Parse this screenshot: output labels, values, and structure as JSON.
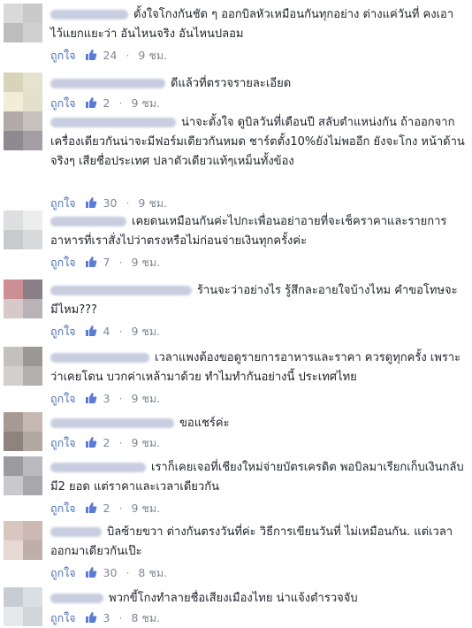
{
  "like_label": "ถูกใจ",
  "dot": "·",
  "comments": [
    {
      "text": "ตั้งใจโกงกันชัด ๆ ออกบิลหัวเหมือนกันทุกอย่าง ต่างแค่วันที่ คงเอาไว้แยกแยะว่า อันไหนจริง อันไหนปลอม",
      "likes": "24",
      "time": "9 ชม."
    },
    {
      "text": "ดีแล้วที่ตรวจรายละเอียด",
      "likes": "2",
      "time": "9 ชม."
    },
    {
      "text": "น่าจะตั้งใจ ดูบิลวันที่เดือนปี สลับตำแหน่งกัน ถ้าออกจากเครื่องเดียวกันน่าจะมีฟอร์มเดียวกันหมด ชาร์ตตั้ง10%ยังไม่พออีก ยังจะโกง หน้าด้านจริงๆ เสียชื่อประเทศ ปลาตัวเดียวแท้ๆเหม็นทั้งข้อง",
      "likes": "30",
      "time": "9 ชม."
    },
    {
      "text": "เคยดนเหมือนกันค่ะไปกะเพื่อนอย่าอายที่จะเช็คราคาและรายการอาหารที่เราสั่งไปว่าตรงหรือไม่ก่อนจ่ายเงินทุกครั้งค่ะ",
      "likes": "7",
      "time": "9 ชม."
    },
    {
      "text": "ร้านจะว่าอย่างไร รู้สึกละอายใจบ้างไหม คำขอโทษจะมีไหม???",
      "likes": "4",
      "time": "9 ชม."
    },
    {
      "text": "เวลาแพงต้องขอดูรายการอาหารและราคา ควรดูทุกครั้ง เพราะว่าเคยโดน บวกค่าเหล้ามาด้วย ทำไมทำกันอย่างนี้ ประเทศไทย",
      "likes": "3",
      "time": "9 ชม."
    },
    {
      "text": "ขอแชร์ค่ะ",
      "likes": "2",
      "time": "9 ชม."
    },
    {
      "text": "เราก็เคยเจอที่เชียงใหม่จ่ายบัตรเครดิต พอบิลมาเรียกเก็บเงินกลับมี2 ยอด แต่ราคาและเวลาเดียวกัน",
      "likes": "2",
      "time": "9 ชม."
    },
    {
      "text": "บิลซ้ายขวา ต่างกันตรงวันที่ค่ะ วิธีการเขียนวันที่ ไม่เหมือนกัน. แต่เวลาออกมาเดียวกันเป๊ะ",
      "likes": "30",
      "time": "8 ชม."
    },
    {
      "text": "พวกขี้โกงทำลายชื่อเสียงเมืองไทย น่าแจ้งตำรวจจับ",
      "likes": "3",
      "time": "8 ชม."
    }
  ],
  "colors": {
    "link": "#4b6fb5",
    "meta": "#7f8793",
    "text": "#1d2129"
  }
}
